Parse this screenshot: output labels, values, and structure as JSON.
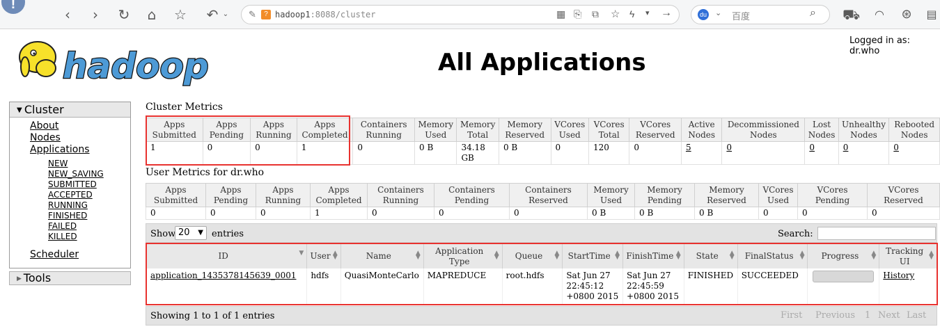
{
  "browser": {
    "url_host": "hadoop1",
    "url_rest": ":8088/cluster",
    "search_placeholder": "百度"
  },
  "header": {
    "logo_text": "hadoop",
    "title": "All Applications",
    "logged_in": "Logged in as: dr.who"
  },
  "nav": {
    "cluster_label": "Cluster",
    "items": [
      "About",
      "Nodes",
      "Applications"
    ],
    "sub_items": [
      "NEW",
      "NEW_SAVING",
      "SUBMITTED",
      "ACCEPTED",
      "RUNNING",
      "FINISHED",
      "FAILED",
      "KILLED"
    ],
    "scheduler": "Scheduler",
    "tools_label": "Tools"
  },
  "cluster_metrics": {
    "caption": "Cluster Metrics",
    "headers": [
      [
        "Apps",
        "Submitted"
      ],
      [
        "Apps",
        "Pending"
      ],
      [
        "Apps",
        "Running"
      ],
      [
        "Apps",
        "Completed"
      ],
      [
        "Containers",
        "Running"
      ],
      [
        "Memory",
        "Used"
      ],
      [
        "Memory",
        "Total"
      ],
      [
        "Memory",
        "Reserved"
      ],
      [
        "VCores",
        "Used"
      ],
      [
        "VCores",
        "Total"
      ],
      [
        "VCores",
        "Reserved"
      ],
      [
        "Active",
        "Nodes"
      ],
      [
        "Decommissioned",
        "Nodes"
      ],
      [
        "Lost",
        "Nodes"
      ],
      [
        "Unhealthy",
        "Nodes"
      ],
      [
        "Rebooted",
        "Nodes"
      ]
    ],
    "values": [
      "1",
      "0",
      "0",
      "1",
      "0",
      "0 B",
      "34.18 GB",
      "0 B",
      "0",
      "120",
      "0",
      "5",
      "0",
      "0",
      "0",
      "0"
    ]
  },
  "user_metrics": {
    "caption": "User Metrics for dr.who",
    "headers": [
      [
        "Apps",
        "Submitted"
      ],
      [
        "Apps",
        "Pending"
      ],
      [
        "Apps",
        "Running"
      ],
      [
        "Apps",
        "Completed"
      ],
      [
        "Containers",
        "Running"
      ],
      [
        "Containers",
        "Pending"
      ],
      [
        "Containers",
        "Reserved"
      ],
      [
        "Memory",
        "Used"
      ],
      [
        "Memory",
        "Pending"
      ],
      [
        "Memory",
        "Reserved"
      ],
      [
        "VCores",
        "Used"
      ],
      [
        "VCores",
        "Pending"
      ],
      [
        "VCores",
        "Reserved"
      ]
    ],
    "values": [
      "0",
      "0",
      "0",
      "1",
      "0",
      "0",
      "0",
      "0 B",
      "0 B",
      "0 B",
      "0",
      "0",
      "0"
    ]
  },
  "apps_table": {
    "show_label": "Show",
    "entries_value": "20",
    "entries_label": "entries",
    "search_label": "Search:",
    "columns": [
      [
        "ID"
      ],
      [
        "User"
      ],
      [
        "Name"
      ],
      [
        "Application",
        "Type"
      ],
      [
        "Queue"
      ],
      [
        "StartTime"
      ],
      [
        "FinishTime"
      ],
      [
        "State"
      ],
      [
        "FinalStatus"
      ],
      [
        "Progress"
      ],
      [
        "Tracking",
        "UI"
      ]
    ],
    "rows": [
      {
        "id": "application_1435378145639_0001",
        "user": "hdfs",
        "name": "QuasiMonteCarlo",
        "type": "MAPREDUCE",
        "queue": "root.hdfs",
        "start": [
          "Sat Jun 27",
          "22:45:12",
          "+0800 2015"
        ],
        "finish": [
          "Sat Jun 27",
          "22:45:59",
          "+0800 2015"
        ],
        "state": "FINISHED",
        "final_status": "SUCCEEDED",
        "progress": 1.0,
        "tracking": "History"
      }
    ],
    "footer": "Showing 1 to 1 of 1 entries",
    "pager": [
      "First",
      "Previous",
      "1",
      "Next",
      "Last"
    ]
  },
  "colors": {
    "highlight_box": "#e8322f",
    "logo_yellow": "#f7e12a",
    "logo_blue": "#4d9ad6"
  }
}
